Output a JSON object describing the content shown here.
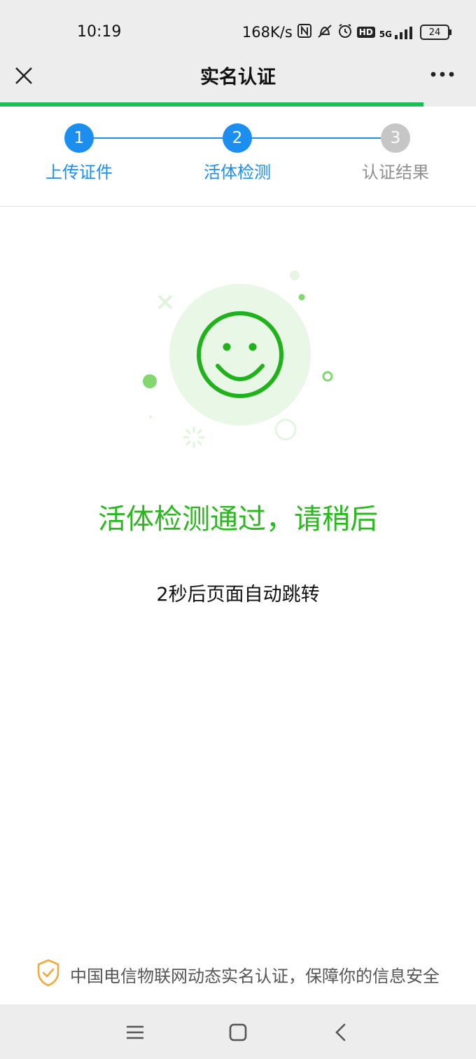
{
  "status_bar": {
    "time": "10:19",
    "speed": "168K/s",
    "network": "5G",
    "hd": "HD",
    "battery": "24",
    "icons": [
      "nfc-icon",
      "mute-icon",
      "alarm-icon",
      "hd-icon",
      "signal-icon",
      "battery-icon"
    ]
  },
  "header": {
    "title": "实名认证",
    "close_icon": "close-icon",
    "more_icon": "more-icon",
    "progress": 0.89
  },
  "steps": [
    {
      "number": "1",
      "label": "上传证件",
      "state": "done"
    },
    {
      "number": "2",
      "label": "活体检测",
      "state": "active"
    },
    {
      "number": "3",
      "label": "认证结果",
      "state": "pending"
    }
  ],
  "result": {
    "title": "活体检测通过，请稍后",
    "subtitle": "2秒后页面自动跳转",
    "icon": "smile-face-icon"
  },
  "footer": {
    "text": "中国电信物联网动态实名认证，保障你的信息安全",
    "icon": "shield-check-icon"
  },
  "colors": {
    "accent_blue": "#1b8ef0",
    "success_green": "#2bb71f",
    "progress_green": "#1fbd4f",
    "pending_gray": "#c6c6c6",
    "shield_orange": "#f2a83a"
  },
  "system_nav": [
    "menu-icon",
    "home-icon",
    "back-icon"
  ]
}
